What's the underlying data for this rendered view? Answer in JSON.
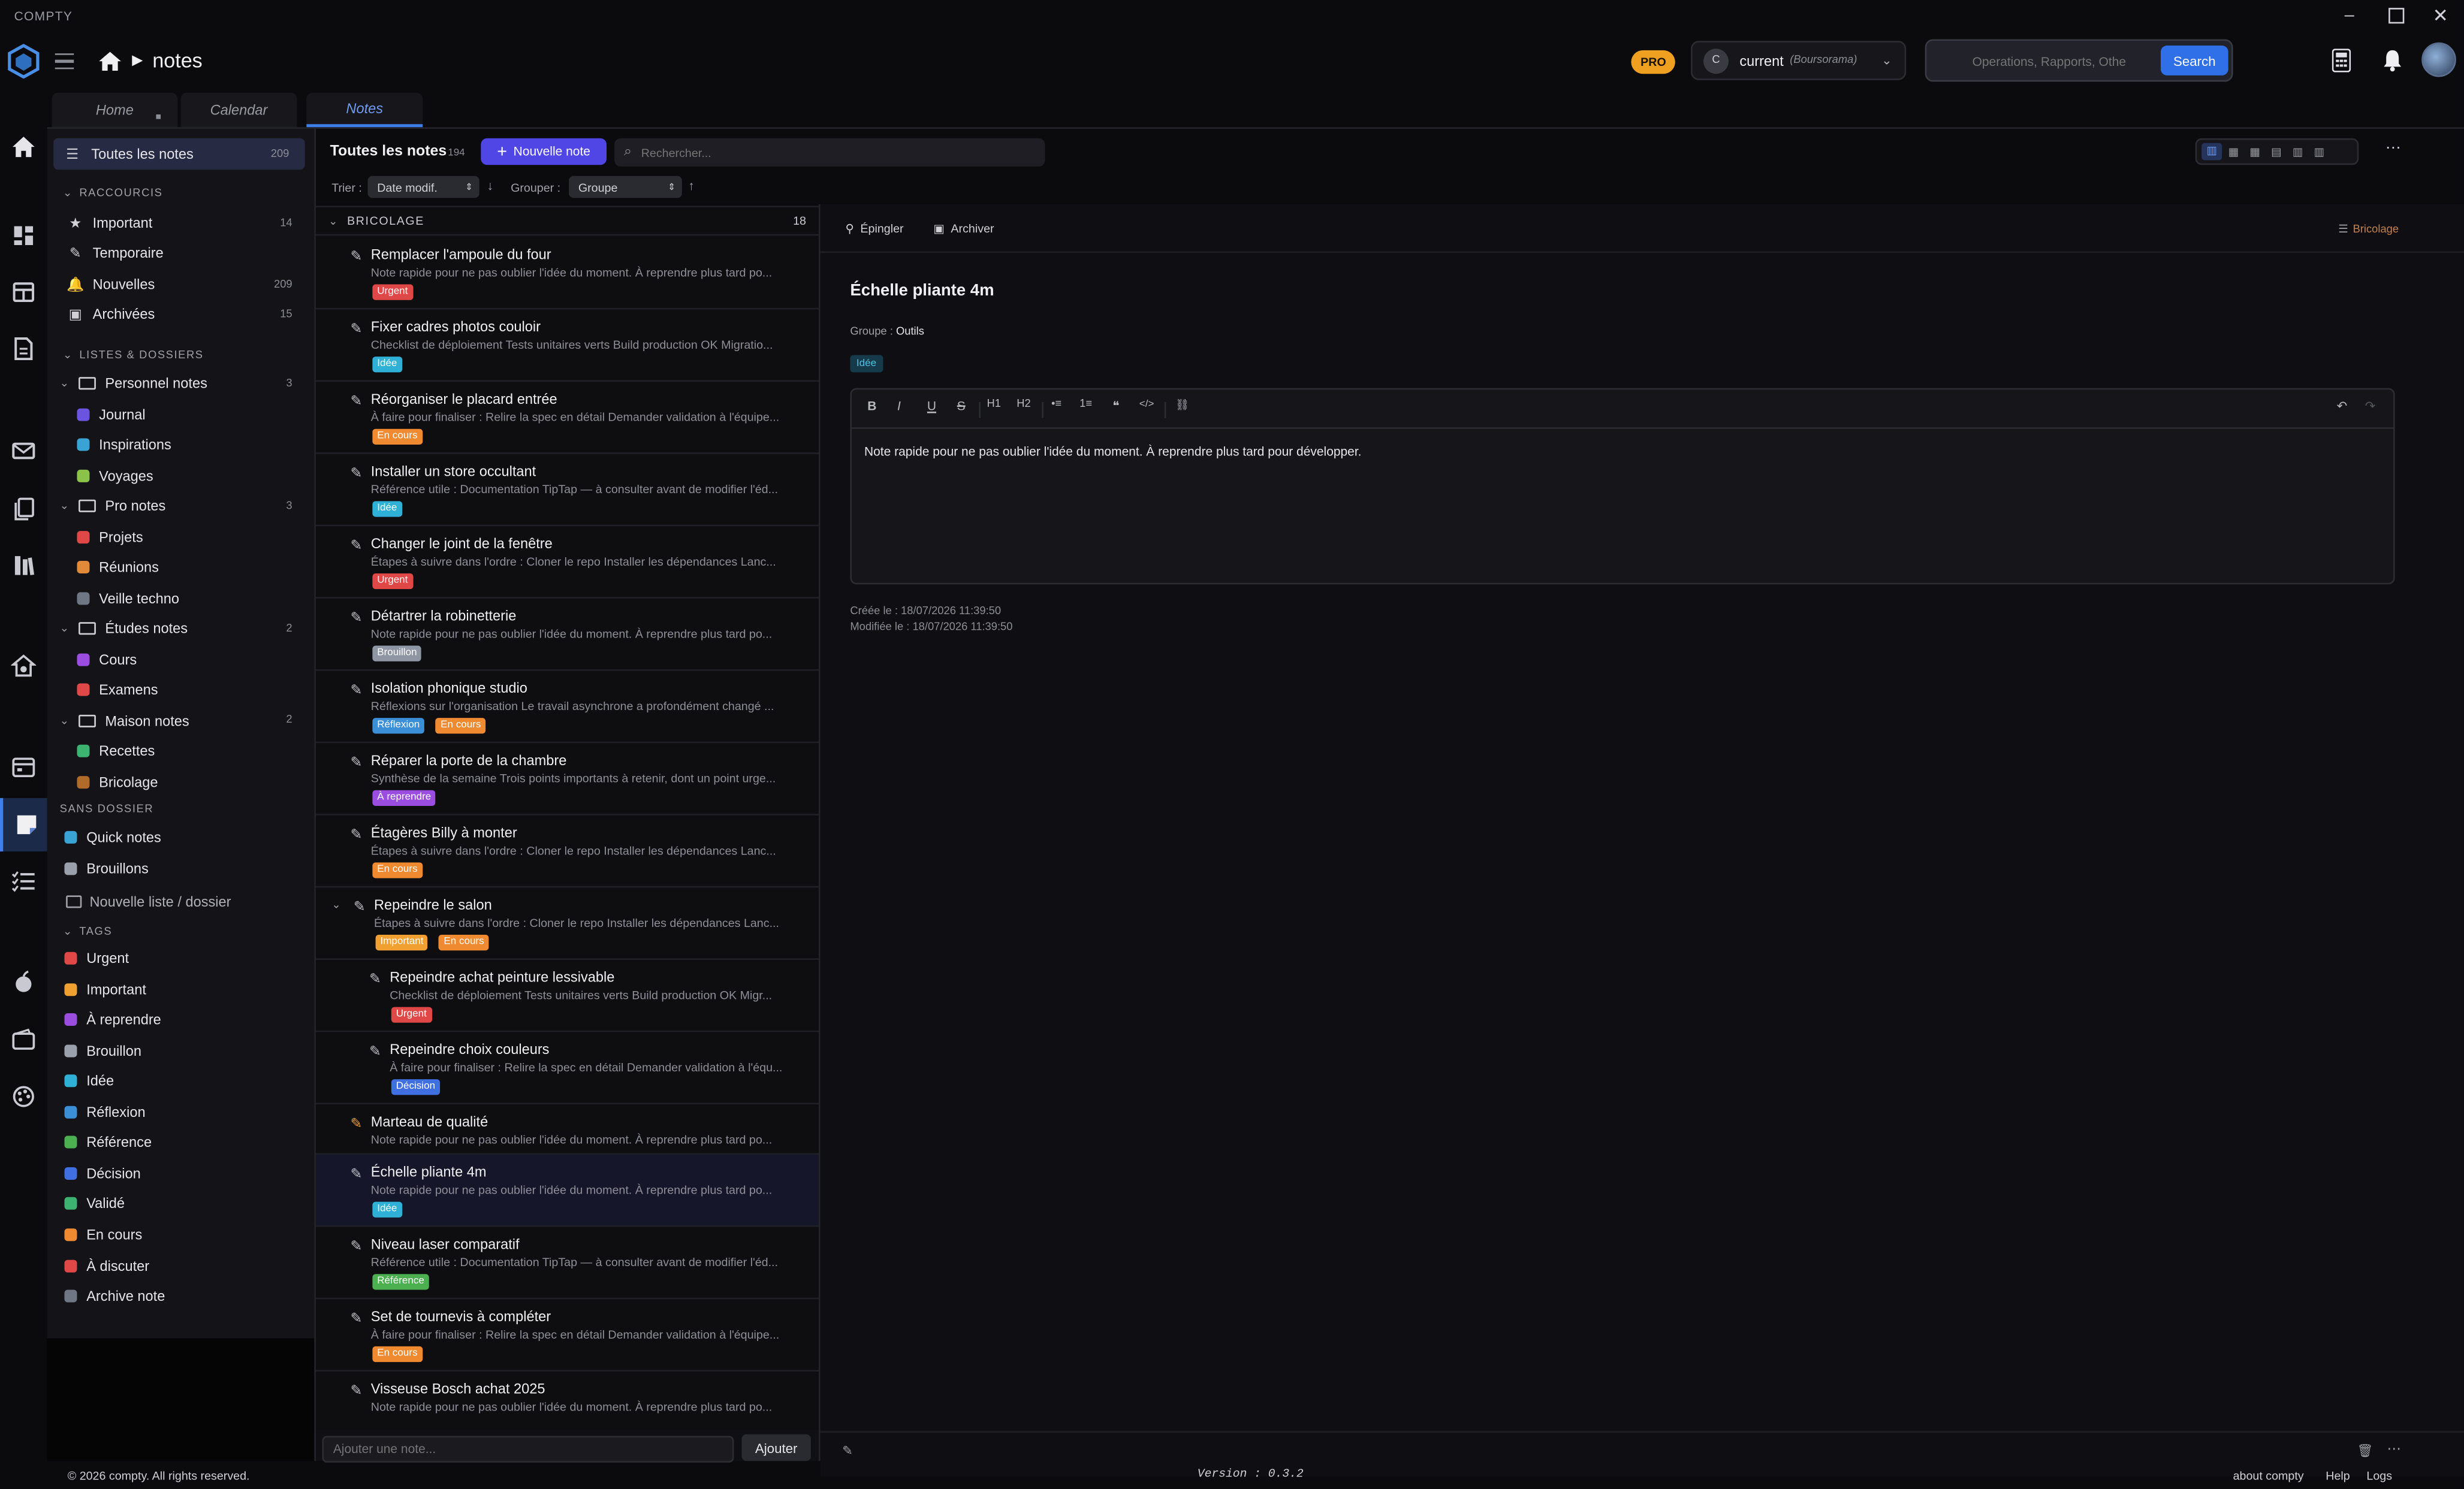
{
  "app": {
    "name": "COMPTY",
    "breadcrumb_page": "notes"
  },
  "topbar": {
    "pro_badge": "PRO",
    "account": {
      "initial": "C",
      "name": "current",
      "bank": "(Boursorama)"
    },
    "search": {
      "placeholder": "Operations, Rapports, Othe",
      "button": "Search"
    }
  },
  "tabs": [
    {
      "label": "Home"
    },
    {
      "label": "Calendar"
    },
    {
      "label": "Notes"
    }
  ],
  "sidebar": {
    "all_notes": {
      "label": "Toutes les notes",
      "count": "209"
    },
    "shortcuts_title": "RACCOURCIS",
    "shortcuts": [
      {
        "label": "Important",
        "count": "14",
        "icon": "star-icon"
      },
      {
        "label": "Temporaire",
        "count": "",
        "icon": "magic-wand-icon"
      },
      {
        "label": "Nouvelles",
        "count": "209",
        "icon": "bell-icon"
      },
      {
        "label": "Archivées",
        "count": "15",
        "icon": "archive-icon"
      }
    ],
    "lists_title": "LISTES & DOSSIERS",
    "folders": [
      {
        "label": "Personnel notes",
        "count": "3",
        "items": [
          {
            "label": "Journal",
            "color": "#6b55e0"
          },
          {
            "label": "Inspirations",
            "color": "#3aa3d6"
          },
          {
            "label": "Voyages",
            "color": "#8bc34a"
          }
        ]
      },
      {
        "label": "Pro notes",
        "count": "3",
        "items": [
          {
            "label": "Projets",
            "color": "#e04848"
          },
          {
            "label": "Réunions",
            "color": "#e08a3a"
          },
          {
            "label": "Veille techno",
            "color": "#6f7684"
          }
        ]
      },
      {
        "label": "Études notes",
        "count": "2",
        "items": [
          {
            "label": "Cours",
            "color": "#9b4de0"
          },
          {
            "label": "Examens",
            "color": "#e04848"
          }
        ]
      },
      {
        "label": "Maison notes",
        "count": "2",
        "items": [
          {
            "label": "Recettes",
            "color": "#3cb371"
          },
          {
            "label": "Bricolage",
            "color": "#b06a2a"
          }
        ]
      }
    ],
    "no_folder_title": "SANS DOSSIER",
    "no_folder": [
      {
        "label": "Quick notes",
        "color": "#3aa3d6"
      },
      {
        "label": "Brouillons",
        "color": "#9aa1ad"
      }
    ],
    "new_list": "Nouvelle liste / dossier",
    "tags_title": "TAGS",
    "tags": [
      {
        "label": "Urgent",
        "color": "#e04848"
      },
      {
        "label": "Important",
        "color": "#f0a030"
      },
      {
        "label": "À reprendre",
        "color": "#9b4de0"
      },
      {
        "label": "Brouillon",
        "color": "#9aa1ad"
      },
      {
        "label": "Idée",
        "color": "#2fb0d6"
      },
      {
        "label": "Réflexion",
        "color": "#3a8fd6"
      },
      {
        "label": "Référence",
        "color": "#4caf50"
      },
      {
        "label": "Décision",
        "color": "#3f6fe0"
      },
      {
        "label": "Validé",
        "color": "#3cb371"
      },
      {
        "label": "En cours",
        "color": "#f08a30"
      },
      {
        "label": "À discuter",
        "color": "#e04848"
      },
      {
        "label": "Archive note",
        "color": "#6f7684"
      }
    ]
  },
  "list": {
    "title": "Toutes les notes",
    "count": "194",
    "new_button": "Nouvelle note",
    "search_placeholder": "Rechercher...",
    "sort_label": "Trier :",
    "sort_value": "Date modif.",
    "group_label": "Grouper :",
    "group_value": "Groupe",
    "group_header": {
      "label": "BRICOLAGE",
      "count": "18"
    },
    "notes": [
      {
        "title": "Remplacer l'ampoule du four",
        "preview": "Note rapide pour ne pas oublier l'idée du moment. À reprendre plus tard po...",
        "tags": [
          {
            "label": "Urgent",
            "color": "#e04848"
          }
        ]
      },
      {
        "title": "Fixer cadres photos couloir",
        "preview": "Checklist de déploiement Tests unitaires verts Build production OK Migratio...",
        "tags": [
          {
            "label": "Idée",
            "color": "#2fb0d6"
          }
        ]
      },
      {
        "title": "Réorganiser le placard entrée",
        "preview": "À faire pour finaliser : Relire la spec en détail Demander validation à l'équipe...",
        "tags": [
          {
            "label": "En cours",
            "color": "#f08a30"
          }
        ]
      },
      {
        "title": "Installer un store occultant",
        "preview": "Référence utile : Documentation TipTap — à consulter avant de modifier l'éd...",
        "tags": [
          {
            "label": "Idée",
            "color": "#2fb0d6"
          }
        ]
      },
      {
        "title": "Changer le joint de la fenêtre",
        "preview": "Étapes à suivre dans l'ordre : Cloner le repo Installer les dépendances Lanc...",
        "tags": [
          {
            "label": "Urgent",
            "color": "#e04848"
          }
        ]
      },
      {
        "title": "Détartrer la robinetterie",
        "preview": "Note rapide pour ne pas oublier l'idée du moment. À reprendre plus tard po...",
        "tags": [
          {
            "label": "Brouillon",
            "color": "#8f96a3"
          }
        ]
      },
      {
        "title": "Isolation phonique studio",
        "preview": "Réflexions sur l'organisation Le travail asynchrone a profondément changé ...",
        "tags": [
          {
            "label": "Réflexion",
            "color": "#3a8fd6"
          },
          {
            "label": "En cours",
            "color": "#f08a30"
          }
        ]
      },
      {
        "title": "Réparer la porte de la chambre",
        "preview": "Synthèse de la semaine Trois points importants à retenir, dont un point urge...",
        "tags": [
          {
            "label": "À reprendre",
            "color": "#9b4de0"
          }
        ]
      },
      {
        "title": "Étagères Billy à monter",
        "preview": "Étapes à suivre dans l'ordre : Cloner le repo Installer les dépendances Lanc...",
        "tags": [
          {
            "label": "En cours",
            "color": "#f08a30"
          }
        ]
      },
      {
        "title": "Repeindre le salon",
        "preview": "Étapes à suivre dans l'ordre : Cloner le repo Installer les dépendances Lanc...",
        "tags": [
          {
            "label": "Important",
            "color": "#f0a030"
          },
          {
            "label": "En cours",
            "color": "#f08a30"
          }
        ]
      },
      {
        "title": "Repeindre achat peinture lessivable",
        "preview": "Checklist de déploiement Tests unitaires verts Build production OK Migr...",
        "tags": [
          {
            "label": "Urgent",
            "color": "#e04848"
          }
        ]
      },
      {
        "title": "Repeindre choix couleurs",
        "preview": "À faire pour finaliser : Relire la spec en détail Demander validation à l'équ...",
        "tags": [
          {
            "label": "Décision",
            "color": "#3f6fe0"
          }
        ]
      },
      {
        "title": "Marteau de qualité",
        "preview": "Note rapide pour ne pas oublier l'idée du moment. À reprendre plus tard po...",
        "tags": []
      },
      {
        "title": "Échelle pliante 4m",
        "preview": "Note rapide pour ne pas oublier l'idée du moment. À reprendre plus tard po...",
        "tags": [
          {
            "label": "Idée",
            "color": "#2fb0d6"
          }
        ]
      },
      {
        "title": "Niveau laser comparatif",
        "preview": "Référence utile : Documentation TipTap — à consulter avant de modifier l'éd...",
        "tags": [
          {
            "label": "Référence",
            "color": "#4caf50"
          }
        ]
      },
      {
        "title": "Set de tournevis à compléter",
        "preview": "À faire pour finaliser : Relire la spec en détail Demander validation à l'équipe...",
        "tags": [
          {
            "label": "En cours",
            "color": "#f08a30"
          }
        ]
      },
      {
        "title": "Visseuse Bosch achat 2025",
        "preview": "Note rapide pour ne pas oublier l'idée du moment. À reprendre plus tard po...",
        "tags": []
      }
    ],
    "add_placeholder": "Ajouter une note...",
    "add_button": "Ajouter"
  },
  "editor": {
    "pin_label": "Épingler",
    "archive_label": "Archiver",
    "folder_label": "Bricolage",
    "title": "Échelle pliante 4m",
    "group_label": "Groupe :",
    "group_value": "Outils",
    "tag": "Idée",
    "body": "Note rapide pour ne pas oublier l'idée du moment. À reprendre plus tard pour développer.",
    "created": "Créée le : 18/07/2026 11:39:50",
    "modified": "Modifiée le : 18/07/2026 11:39:50",
    "toolbar": [
      "B",
      "I",
      "U",
      "S",
      "H1",
      "H2",
      "•≡",
      "1≡",
      "❝",
      "</>",
      "⛓"
    ]
  },
  "footer": {
    "copyright": "© 2026 compty. All rights reserved.",
    "version": "Version : 0.3.2",
    "links": [
      "about compty",
      "Help",
      "Logs"
    ]
  }
}
